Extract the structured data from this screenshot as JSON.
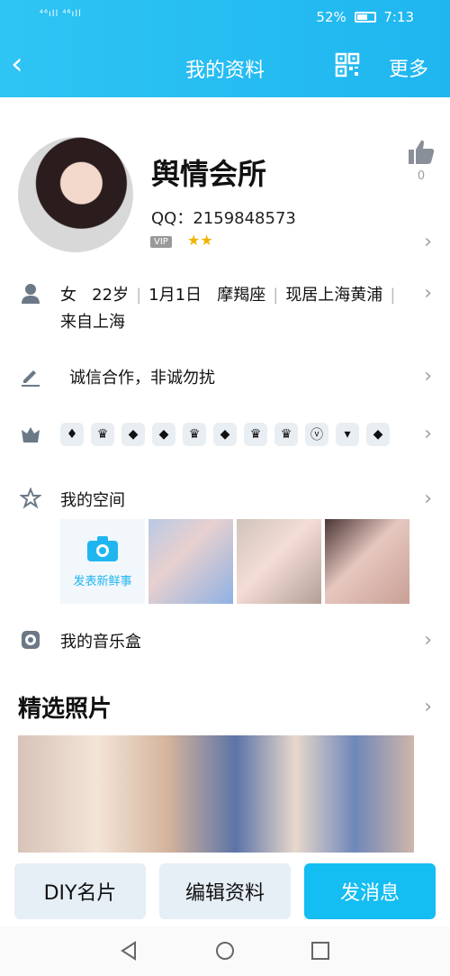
{
  "status": {
    "signal": "⁴⁶ıll ⁴⁶ıll",
    "battery": "52%",
    "time": "7:13"
  },
  "header": {
    "title": "我的资料",
    "more": "更多",
    "back": "‹"
  },
  "profile": {
    "name": "舆情会所",
    "qq": "QQ：2159848573",
    "vip": "VIP",
    "stars": "★★",
    "likes": "0"
  },
  "info": {
    "gender": "女",
    "age": "22岁",
    "birthday": "1月1日",
    "zodiac": "摩羯座",
    "residence": "现居上海黄浦",
    "hometown": "来自上海"
  },
  "signature": "诚信合作，非诚勿扰",
  "badges": [
    "♦",
    "♛",
    "◆",
    "◆",
    "♛",
    "◆",
    "♛",
    "♛",
    "ⓥ",
    "▾",
    "◆"
  ],
  "space": {
    "label": "我的空间",
    "post_label": "发表新鲜事"
  },
  "music": {
    "label": "我的音乐盒"
  },
  "photos": {
    "title": "精选照片"
  },
  "actions": {
    "diy": "DIY名片",
    "edit": "编辑资料",
    "message": "发消息"
  }
}
